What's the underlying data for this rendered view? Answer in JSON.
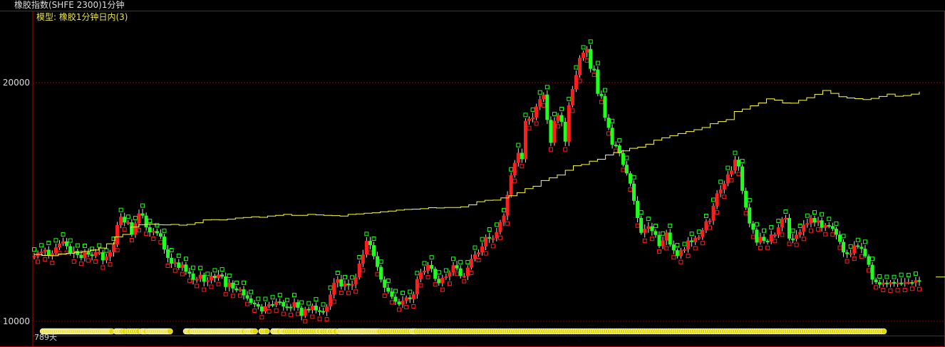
{
  "window": {
    "title": "橡胶指数(SHFE 2300)1分钟"
  },
  "model": {
    "label": "模型: 橡胶1分钟日内(3)"
  },
  "footer": {
    "day_count": "789天"
  },
  "colors": {
    "up": "#ff1e1e",
    "down": "#1eff1e",
    "flat": "#d8d8d8",
    "equity": "#ffff3c",
    "signal": "#e0d800",
    "grid": "#8a0000",
    "frame": "#c00000"
  },
  "chart_data": [
    {
      "type": "line",
      "series": [
        {
          "role": "price",
          "values": [
            12740,
            12880,
            12920,
            13000,
            12760,
            12860,
            13100,
            13260,
            13350,
            13150,
            12840,
            12950,
            12780,
            12650,
            12900,
            12800,
            12750,
            12900,
            12900,
            12560,
            12710,
            12900,
            13220,
            14030,
            14380,
            14140,
            14150,
            13630,
            14110,
            14520,
            14430,
            13940,
            13730,
            13780,
            13690,
            13550,
            13010,
            12660,
            12420,
            12470,
            12240,
            12380,
            12080,
            12000,
            11740,
            11780,
            11950,
            11660,
            11720,
            11910,
            11810,
            11960,
            11880,
            11440,
            11620,
            11380,
            11300,
            11340,
            11090,
            10960,
            10780,
            10720,
            10620,
            10420,
            10630,
            10720,
            10680,
            10830,
            10810,
            10620,
            10610,
            10600,
            10800,
            10570,
            10230,
            10520,
            10480,
            10660,
            10460,
            10430,
            10410,
            10620,
            11120,
            11620,
            11760,
            11460,
            11580,
            11510,
            11560,
            11840,
            12420,
            12800,
            13370,
            13190,
            12730,
            12280,
            11750,
            11410,
            11250,
            11030,
            10830,
            10710,
            10860,
            11000,
            10930,
            11140,
            11770,
            12050,
            12120,
            12360,
            12200,
            11780,
            11600,
            11820,
            11880,
            12050,
            12350,
            12220,
            11900,
            11900,
            12250,
            12620,
            12810,
            12890,
            13140,
            13530,
            13480,
            13480,
            13740,
            14160,
            14430,
            15300,
            16120,
            16640,
            17060,
            16800,
            18400,
            18490,
            18540,
            19000,
            19310,
            19500,
            18440,
            17480,
            18400,
            18640,
            18360,
            17530,
            19050,
            19730,
            20320,
            21040,
            21260,
            21410,
            20580,
            20550,
            19530,
            19440,
            18530,
            18110,
            17400,
            17370,
            17050,
            16560,
            16200,
            15770,
            15050,
            14330,
            13710,
            13880,
            13980,
            13780,
            13620,
            13150,
            13390,
            13720,
            13220,
            12980,
            12740,
            12980,
            13020,
            13390,
            13320,
            13500,
            13530,
            13820,
            14190,
            14220,
            14840,
            15360,
            15520,
            15770,
            16160,
            16320,
            16770,
            16490,
            15470,
            14770,
            14100,
            13840,
            13300,
            13540,
            13370,
            13350,
            13640,
            13640,
            13940,
            14290,
            14330,
            13470,
            13450,
            13630,
            13750,
            14050,
            14110,
            14330,
            14140,
            14230,
            13920,
            14030,
            13990,
            13880,
            13630,
            13330,
            12890,
            12820,
            12850,
            13180,
            13120,
            13040,
            12730,
            12370,
            11750,
            11640,
            11540,
            11620,
            11560,
            11640,
            11600,
            11620,
            11610,
            11630,
            11640,
            11620,
            11720,
            11660
          ]
        },
        {
          "role": "equity",
          "values": [
            12800,
            12760,
            12750,
            12820,
            12850,
            12890,
            12930,
            12990,
            13070,
            13250,
            13540,
            13640,
            13950,
            14050,
            14070,
            14050,
            14040,
            14060,
            14030,
            14060,
            14130,
            14250,
            14260,
            14250,
            14280,
            14330,
            14350,
            14380,
            14360,
            14410,
            14440,
            14480,
            14440,
            14440,
            14480,
            14460,
            14440,
            14430,
            14410,
            14480,
            14500,
            14530,
            14550,
            14590,
            14620,
            14660,
            14690,
            14700,
            14720,
            14760,
            14750,
            14770,
            14770,
            14800,
            14880,
            15010,
            15070,
            15080,
            15170,
            15260,
            15390,
            15560,
            15660,
            15900,
            16010,
            16130,
            16330,
            16520,
            16570,
            16710,
            16790,
            16970,
            17070,
            17140,
            17250,
            17300,
            17420,
            17590,
            17690,
            17780,
            17870,
            17950,
            18030,
            18120,
            18280,
            18370,
            18450,
            18790,
            18890,
            19030,
            19150,
            19320,
            19270,
            19150,
            19140,
            19260,
            19370,
            19510,
            19670,
            19550,
            19410,
            19360,
            19330,
            19290,
            19340,
            19420,
            19520,
            19430,
            19460,
            19520,
            19620
          ]
        }
      ],
      "ylim": [
        10000,
        22000
      ],
      "yticks": [
        10000,
        20000
      ],
      "yticks_text": [
        "10000",
        "20000"
      ],
      "grid": true,
      "legend": "none"
    },
    {
      "type": "scatter",
      "series": [
        {
          "role": "position-signal",
          "x": [
            8,
            9,
            10,
            11,
            12,
            13,
            14,
            15,
            16,
            17,
            18,
            19,
            20,
            21,
            22,
            23,
            24,
            25,
            26,
            27,
            28,
            29,
            30,
            31,
            32,
            33,
            34,
            35,
            36,
            37,
            38,
            39,
            40,
            41,
            42,
            43,
            44,
            45,
            46,
            47,
            48,
            49,
            50,
            51,
            52,
            53,
            54,
            55,
            56,
            57,
            58,
            59,
            60,
            61,
            62,
            63,
            64,
            65,
            66,
            67,
            68,
            69,
            70,
            71,
            72,
            76,
            77,
            78,
            79,
            80,
            81,
            82,
            84,
            87,
            89,
            91,
            93,
            95,
            97,
            100,
            101,
            102,
            103,
            104,
            106,
            107,
            108,
            109,
            110,
            111,
            112,
            113,
            114,
            115,
            116,
            117,
            118,
            119,
            120,
            121,
            122,
            123,
            124,
            125,
            126,
            141,
            142,
            143,
            144,
            145,
            147,
            148,
            149,
            149,
            150,
            151,
            152,
            153,
            154,
            155,
            156,
            157,
            158,
            159,
            160,
            161,
            162,
            163,
            164,
            165,
            166,
            167,
            168,
            169,
            170,
            171,
            172,
            173,
            174,
            175,
            176,
            177,
            178,
            179,
            180,
            181,
            182,
            183,
            184,
            185,
            186,
            187,
            188,
            189,
            190,
            191,
            192,
            193,
            194,
            195,
            197,
            198,
            199,
            200,
            201,
            202,
            203,
            205,
            211,
            212,
            214,
            216,
            222,
            223,
            224,
            225,
            226,
            227,
            228,
            230,
            231,
            232,
            233,
            235,
            237,
            239,
            241,
            243,
            245,
            247,
            248,
            250,
            252,
            254,
            256,
            258,
            260,
            262,
            264,
            265,
            267,
            268,
            270,
            272,
            274,
            275,
            277,
            279,
            280,
            283,
            284,
            285,
            286,
            287,
            288,
            289,
            290,
            291,
            292,
            293,
            294,
            295,
            296,
            297,
            298,
            299,
            300,
            301,
            302,
            303,
            304,
            305,
            306,
            307,
            308,
            309,
            310,
            311,
            312,
            313,
            314,
            315,
            316,
            317,
            318,
            319,
            320,
            321,
            323,
            325,
            327,
            329,
            331,
            333,
            335,
            337,
            339,
            341,
            343,
            345,
            347,
            349,
            351,
            352,
            353,
            354,
            355,
            357,
            359,
            361,
            363,
            365,
            367,
            369,
            371,
            373,
            375,
            377,
            379,
            381,
            383,
            385,
            387,
            389,
            391,
            393,
            395,
            397,
            399,
            401,
            403,
            405,
            407,
            409,
            411,
            413,
            415,
            417,
            419,
            421,
            423,
            425,
            427,
            429,
            431,
            433,
            435,
            437,
            439,
            441,
            443,
            445,
            447,
            449,
            451,
            453,
            455,
            457,
            459,
            461,
            463,
            465,
            467,
            469,
            471,
            473,
            475,
            477,
            479,
            481,
            483,
            485,
            487,
            489,
            491,
            493,
            495,
            497,
            499,
            501,
            503,
            505,
            507,
            509,
            511,
            513,
            515,
            517,
            519,
            521,
            523,
            525,
            527,
            529,
            531,
            533,
            535,
            537,
            539,
            541,
            543,
            545,
            547,
            549,
            551,
            553,
            555,
            557,
            559,
            561,
            563,
            565,
            567,
            569,
            571,
            573,
            575,
            577,
            579,
            581,
            583,
            585,
            587,
            589,
            591,
            593,
            595,
            597,
            599,
            601,
            603,
            605,
            607,
            609,
            611,
            613,
            615,
            617,
            619,
            621,
            623,
            625,
            627,
            629,
            631,
            633,
            635,
            637,
            639,
            641,
            643,
            645,
            647,
            649,
            651,
            653,
            655,
            657,
            659,
            661,
            663,
            665,
            667,
            669,
            671,
            673,
            675,
            677,
            679,
            681,
            683,
            685,
            687,
            689,
            691,
            693,
            695,
            697,
            699,
            701,
            703,
            705,
            707,
            709,
            711,
            713,
            715,
            717,
            719,
            721,
            723,
            725,
            727,
            729,
            731,
            733,
            735,
            737,
            739,
            741,
            743,
            745,
            747,
            749,
            751,
            753,
            755,
            757,
            759,
            761,
            763,
            765,
            767,
            769,
            771,
            773,
            775,
            777,
            779,
            781,
            783,
            785,
            787,
            789
          ]
        }
      ]
    }
  ]
}
